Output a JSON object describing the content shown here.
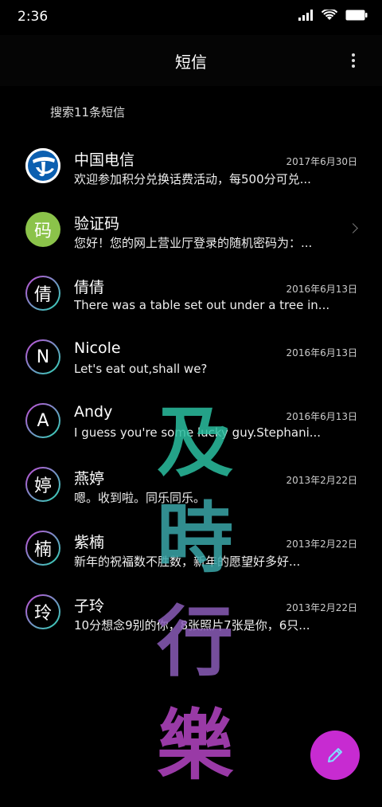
{
  "status_bar": {
    "time": "2:36"
  },
  "header": {
    "title": "短信"
  },
  "search": {
    "label": "搜索11条短信"
  },
  "conversations": [
    {
      "avatar": "",
      "avatar_type": "telecom-logo",
      "name": "中国电信",
      "date": "2017年6月30日",
      "preview": "欢迎参加积分兑换话费活动，每500分可兑..."
    },
    {
      "avatar": "码",
      "avatar_type": "green",
      "name": "验证码",
      "date": "",
      "preview": "您好！您的网上营业厅登录的随机密码为：..."
    },
    {
      "avatar": "倩",
      "avatar_type": "ring",
      "name": "倩倩",
      "date": "2016年6月13日",
      "preview": "There was a table set out under a tree in..."
    },
    {
      "avatar": "N",
      "avatar_type": "ring",
      "name": "Nicole",
      "date": "2016年6月13日",
      "preview": "Let's eat out,shall we?"
    },
    {
      "avatar": "A",
      "avatar_type": "ring",
      "name": "Andy",
      "date": "2016年6月13日",
      "preview": "I guess you're some lucky guy.Stephani..."
    },
    {
      "avatar": "婷",
      "avatar_type": "ring",
      "name": "燕婷",
      "date": "2013年2月22日",
      "preview": "嗯。收到啦。同乐同乐。"
    },
    {
      "avatar": "楠",
      "avatar_type": "ring",
      "name": "紫楠",
      "date": "2013年2月22日",
      "preview": "新年的祝福数不胜数，新年的愿望好多好..."
    },
    {
      "avatar": "玲",
      "avatar_type": "ring",
      "name": "子玲",
      "date": "2013年2月22日",
      "preview": "10分想念9别的你，8张照片7张是你，6只..."
    }
  ],
  "watermark": {
    "chars": [
      "及",
      "時",
      "行",
      "樂"
    ],
    "colors": [
      "#2bbfa0",
      "#3aa6a8",
      "#8a5cb8",
      "#b445c4"
    ]
  },
  "colors": {
    "fab": "#c72bd1",
    "accent_ring_start": "#c54ad8",
    "accent_ring_end": "#2bd8b4"
  },
  "icons": {
    "fab": "pencil-icon",
    "more": "more-vertical-icon",
    "search": "search-icon"
  }
}
